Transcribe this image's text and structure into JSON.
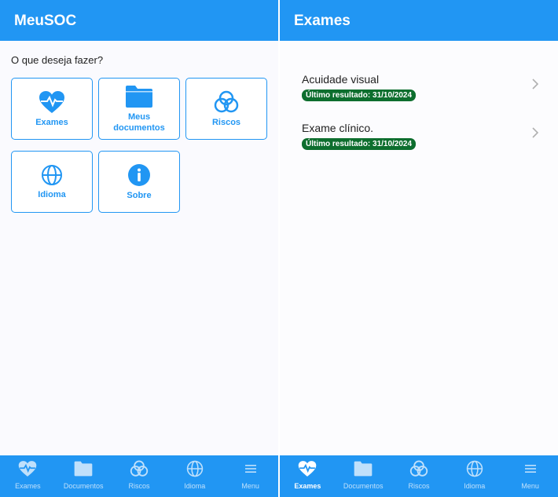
{
  "left": {
    "app_title": "MeuSOC",
    "prompt": "O que deseja fazer?",
    "tiles": [
      {
        "label": "Exames",
        "icon": "heart-pulse-icon"
      },
      {
        "label": "Meus documentos",
        "icon": "folder-icon"
      },
      {
        "label": "Riscos",
        "icon": "circles-icon"
      },
      {
        "label": "Idioma",
        "icon": "globe-icon"
      },
      {
        "label": "Sobre",
        "icon": "info-icon"
      }
    ]
  },
  "right": {
    "title": "Exames",
    "items": [
      {
        "name": "Acuidade visual",
        "status": "Último resultado: 31/10/2024"
      },
      {
        "name": "Exame clínico.",
        "status": "Último resultado: 31/10/2024"
      }
    ]
  },
  "tabs": [
    {
      "label": "Exames",
      "icon": "heart-pulse-icon"
    },
    {
      "label": "Documentos",
      "icon": "folder-icon"
    },
    {
      "label": "Riscos",
      "icon": "circles-icon"
    },
    {
      "label": "Idioma",
      "icon": "globe-icon"
    },
    {
      "label": "Menu",
      "icon": "menu-icon"
    }
  ],
  "colors": {
    "primary": "#2196f3",
    "badge": "#0d6e2e"
  }
}
